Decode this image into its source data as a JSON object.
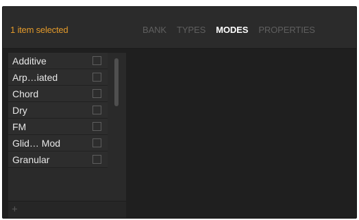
{
  "header": {
    "selection_text": "1 item selected",
    "tabs": [
      {
        "label": "BANK",
        "active": false
      },
      {
        "label": "TYPES",
        "active": false
      },
      {
        "label": "MODES",
        "active": true
      },
      {
        "label": "PROPERTIES",
        "active": false
      }
    ]
  },
  "list": {
    "items": [
      {
        "label": "Additive",
        "checked": false
      },
      {
        "label": "Arp…iated",
        "checked": false
      },
      {
        "label": "Chord",
        "checked": false
      },
      {
        "label": "Dry",
        "checked": false
      },
      {
        "label": "FM",
        "checked": false
      },
      {
        "label": "Glid… Mod",
        "checked": false
      },
      {
        "label": "Granular",
        "checked": false
      }
    ],
    "add_icon": "plus-icon",
    "add_glyph": "+"
  },
  "colors": {
    "accent": "#e39a2b",
    "active_tab": "#ffffff",
    "inactive_tab": "#5f5f5f"
  }
}
